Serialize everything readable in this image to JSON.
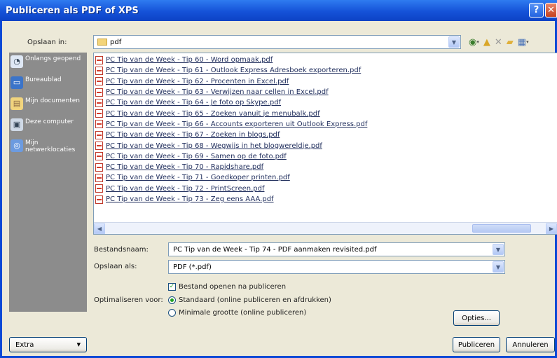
{
  "window": {
    "title": "Publiceren als PDF of XPS",
    "help_glyph": "?",
    "close_glyph": "✕"
  },
  "save_in": {
    "label": "Opslaan in:",
    "value": "pdf"
  },
  "toolbar_icons": [
    "back-icon",
    "up-folder-icon",
    "delete-icon",
    "new-folder-icon",
    "views-icon"
  ],
  "places": [
    {
      "name": "recent",
      "label": "Onlangs geopend",
      "icon": "recent-documents-icon"
    },
    {
      "name": "desktop",
      "label": "Bureaublad",
      "icon": "desktop-icon"
    },
    {
      "name": "documents",
      "label": "Mijn documenten",
      "icon": "my-documents-icon"
    },
    {
      "name": "computer",
      "label": "Deze computer",
      "icon": "my-computer-icon"
    },
    {
      "name": "network",
      "label": "Mijn netwerklocaties",
      "icon": "network-places-icon"
    }
  ],
  "files": [
    "PC Tip van de Week - Tip 60 - Word opmaak.pdf",
    "PC Tip van de Week - Tip 61 - Outlook Express Adresboek exporteren.pdf",
    "PC Tip van de Week - Tip 62 - Procenten in Excel.pdf",
    "PC Tip van de Week - Tip 63 - Verwijzen naar cellen in Excel.pdf",
    "PC Tip van de Week - Tip 64 - Je foto op Skype.pdf",
    "PC Tip van de Week - Tip 65 - Zoeken vanuit je menubalk.pdf",
    "PC Tip van de Week - Tip 66 - Accounts exporteren uit Outlook Express.pdf",
    "PC Tip van de Week - Tip 67 - Zoeken in blogs.pdf",
    "PC Tip van de Week - Tip 68 - Wegwijs in het blogwereldje.pdf",
    "PC Tip van de Week - Tip 69 - Samen op de foto.pdf",
    "PC Tip van de Week - Tip 70 - Rapidshare.pdf",
    "PC Tip van de Week - Tip 71 - Goedkoper printen.pdf",
    "PC Tip van de Week - Tip 72 - PrintScreen.pdf",
    "PC Tip van de Week - Tip 73 - Zeg eens AAA.pdf"
  ],
  "filename": {
    "label": "Bestandsnaam:",
    "value": "PC Tip van de Week - Tip 74 - PDF aanmaken revisited.pdf"
  },
  "save_as": {
    "label": "Opslaan als:",
    "value": "PDF (*.pdf)"
  },
  "open_after": {
    "label": "Bestand openen na publiceren",
    "checked": true
  },
  "optimize": {
    "label": "Optimaliseren voor:",
    "standard": "Standaard (online publiceren en afdrukken)",
    "minimal": "Minimale grootte (online publiceren)",
    "selected": "standard"
  },
  "buttons": {
    "options": "Opties...",
    "tools": "Extra",
    "publish": "Publiceren",
    "cancel": "Annuleren"
  },
  "colors": {
    "titlebar": "#0a49d6",
    "dialog_bg": "#ece9d8",
    "places_bg": "#8c8c8c"
  }
}
